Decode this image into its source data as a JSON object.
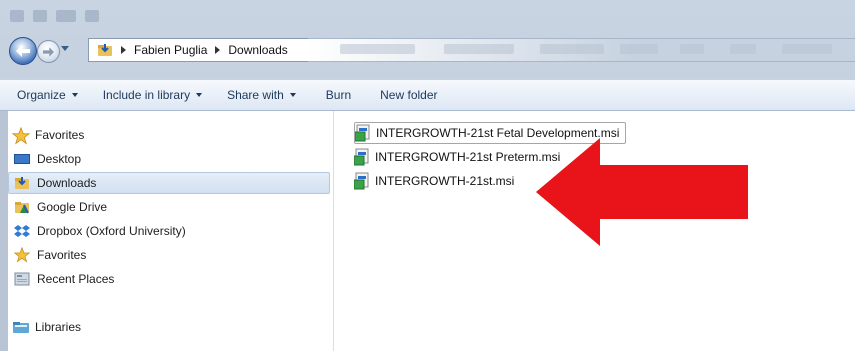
{
  "breadcrumb": [
    "Fabien Puglia",
    "Downloads"
  ],
  "toolbar": {
    "organize": "Organize",
    "include_in_library": "Include in library",
    "share_with": "Share with",
    "burn": "Burn",
    "new_folder": "New folder"
  },
  "nav": {
    "favorites_header": "Favorites",
    "items": [
      "Desktop",
      "Downloads",
      "Google Drive",
      "Dropbox (Oxford University)",
      "Favorites",
      "Recent Places"
    ],
    "libraries": "Libraries"
  },
  "files": [
    "INTERGROWTH-21st Fetal Development.msi",
    "INTERGROWTH-21st Preterm.msi",
    "INTERGROWTH-21st.msi"
  ],
  "annotation": {
    "arrow_color": "#e8141a"
  }
}
